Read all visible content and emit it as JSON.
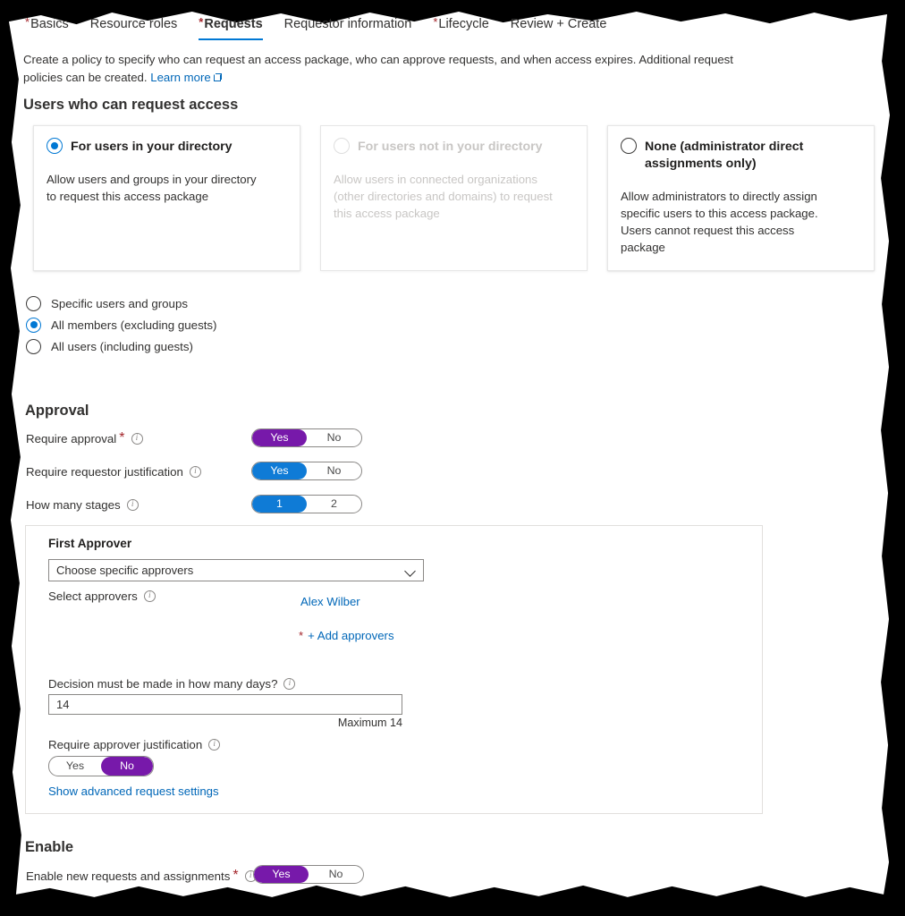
{
  "tabs": [
    {
      "label": "Basics",
      "required": true,
      "active": false
    },
    {
      "label": "Resource roles",
      "required": false,
      "active": false
    },
    {
      "label": "Requests",
      "required": true,
      "active": true
    },
    {
      "label": "Requestor information",
      "required": false,
      "active": false
    },
    {
      "label": "Lifecycle",
      "required": true,
      "active": false
    },
    {
      "label": "Review + Create",
      "required": false,
      "active": false
    }
  ],
  "intro": {
    "text": "Create a policy to specify who can request an access package, who can approve requests, and when access expires. Additional request policies can be created.",
    "link_label": "Learn more",
    "link_icon": "external-link-icon"
  },
  "users_section": {
    "heading": "Users who can request access",
    "cards": [
      {
        "title": "For users in your directory",
        "description": "Allow users and groups in your directory to request this access package",
        "selected": true,
        "disabled": false
      },
      {
        "title": "For users not in your directory",
        "description": "Allow users in connected organizations (other directories and domains) to request this access package",
        "selected": false,
        "disabled": true
      },
      {
        "title": "None (administrator direct assignments only)",
        "description": "Allow administrators to directly assign specific users to this access package. Users cannot request this access package",
        "selected": false,
        "disabled": false
      }
    ],
    "scope_options": [
      {
        "label": "Specific users and groups",
        "selected": false
      },
      {
        "label": "All members (excluding guests)",
        "selected": true
      },
      {
        "label": "All users (including guests)",
        "selected": false
      }
    ]
  },
  "approval_section": {
    "heading": "Approval",
    "rows": [
      {
        "label": "Require approval",
        "required": true,
        "info_icon": "info-icon",
        "toggle": {
          "left": "Yes",
          "right": "No",
          "selected": "Yes",
          "color": "#7719aa"
        }
      },
      {
        "label": "Require requestor justification",
        "required": false,
        "info_icon": "info-icon",
        "toggle": {
          "left": "Yes",
          "right": "No",
          "selected": "Yes",
          "color": "#0f7bd6"
        }
      },
      {
        "label": "How many stages",
        "required": false,
        "info_icon": "info-icon",
        "toggle": {
          "left": "1",
          "right": "2",
          "selected": "1",
          "color": "#0f7bd6"
        }
      }
    ],
    "approver_panel": {
      "title": "First Approver",
      "approver_type_value": "Choose specific approvers",
      "select_approvers_label": "Select approvers",
      "approver_name": "Alex Wilber",
      "add_approvers_label": "+ Add approvers",
      "days_label": "Decision must be made in how many days?",
      "days_value": "14",
      "days_placeholder": "",
      "maximum_note": "Maximum 14",
      "approver_justification_label": "Require approver justification",
      "approver_justification_toggle": {
        "left": "Yes",
        "right": "No",
        "selected": "No",
        "color": "#7719aa"
      },
      "advanced_link": "Show advanced request settings"
    }
  },
  "enable_section": {
    "heading": "Enable",
    "row": {
      "label": "Enable new requests and assignments",
      "required": true,
      "info_icon": "info-icon",
      "toggle": {
        "left": "Yes",
        "right": "No",
        "selected": "Yes",
        "color": "#7719aa"
      }
    }
  }
}
